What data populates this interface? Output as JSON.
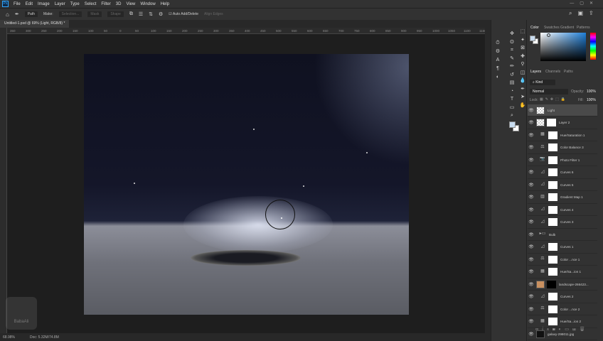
{
  "menu": [
    "File",
    "Edit",
    "Image",
    "Layer",
    "Type",
    "Select",
    "Filter",
    "3D",
    "View",
    "Window",
    "Help"
  ],
  "options": {
    "mode": "Path",
    "make": "Make:",
    "selection": "Selection...",
    "mask": "Mask",
    "shape": "Shape",
    "auto_add_delete": "Auto Add/Delete",
    "align_edges": "Align Edges"
  },
  "document_tab": "Untitled-1.psd @ 69% (Light, RGB/8) *",
  "ruler_ticks": [
    "350",
    "300",
    "250",
    "200",
    "150",
    "100",
    "50",
    "0",
    "50",
    "100",
    "150",
    "200",
    "250",
    "300",
    "350",
    "400",
    "450",
    "500",
    "550",
    "600",
    "650",
    "700",
    "750",
    "800",
    "850",
    "900",
    "950",
    "1000",
    "1050",
    "1100",
    "1150"
  ],
  "status": {
    "zoom": "68.98%",
    "doc": "Doc: 5.32M/74.8M"
  },
  "color_panel": {
    "tabs": [
      "Color",
      "Swatches",
      "Gradient",
      "Patterns"
    ],
    "foreground": "#c8dcf0",
    "background": "#ffffff"
  },
  "layers_panel": {
    "tabs": [
      "Layers",
      "Channels",
      "Paths"
    ],
    "filter": "Kind",
    "blend_mode": "Normal",
    "opacity_label": "Opacity:",
    "opacity": "100%",
    "lock_label": "Lock:",
    "fill_label": "Fill:",
    "fill": "100%",
    "layers": [
      {
        "name": "Light",
        "type": "pixel",
        "selected": true
      },
      {
        "name": "Layer 2",
        "type": "pixel"
      },
      {
        "name": "Hue/Saturation 1",
        "type": "hue"
      },
      {
        "name": "Color Balance 3",
        "type": "balance"
      },
      {
        "name": "Photo Filter 1",
        "type": "photo"
      },
      {
        "name": "Curves 6",
        "type": "curves"
      },
      {
        "name": "Curves 5",
        "type": "curves"
      },
      {
        "name": "Gradient Map 1",
        "type": "gradient"
      },
      {
        "name": "Curves 4",
        "type": "curves"
      },
      {
        "name": "Curves 3",
        "type": "curves"
      },
      {
        "name": "Bulb",
        "type": "group"
      },
      {
        "name": "Curves 1",
        "type": "curves"
      },
      {
        "name": "Color ...nce 1",
        "type": "balance"
      },
      {
        "name": "Hue/Sa...ion 1",
        "type": "hue"
      },
      {
        "name": "landscape-266423...",
        "type": "image"
      },
      {
        "name": "Curves 2",
        "type": "curves"
      },
      {
        "name": "Color ...nce 2",
        "type": "balance"
      },
      {
        "name": "Hue/Sa...ion 2",
        "type": "hue"
      },
      {
        "name": "galaxy-298011.jpg",
        "type": "image"
      }
    ]
  },
  "watermark": "BabaAli"
}
